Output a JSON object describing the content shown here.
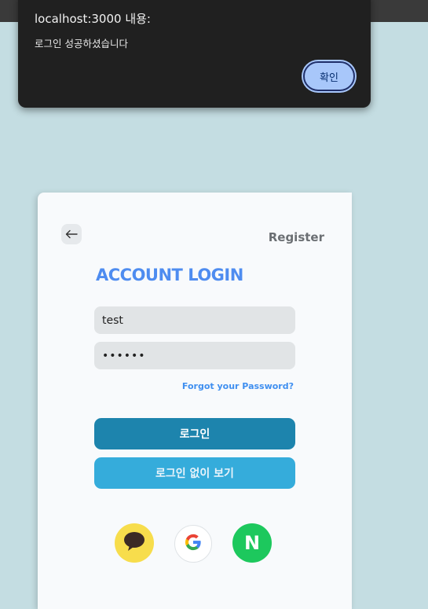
{
  "dialog": {
    "title": "localhost:3000 내용:",
    "message": "로그인 성공하셨습니다",
    "ok_label": "확인"
  },
  "card": {
    "back_icon": "arrow-left-icon",
    "register_label": "Register",
    "title": "ACCOUNT LOGIN",
    "username_value": "test",
    "password_value": "••••••",
    "forgot_label": "Forgot your Password?",
    "login_label": "로그인",
    "guest_label": "로그인 없이 보기",
    "social": {
      "kakao_icon": "kakao-talk-icon",
      "google_icon": "google-icon",
      "naver_icon": "naver-icon",
      "naver_letter": "N"
    }
  },
  "colors": {
    "background": "#c4dde2",
    "title": "#4e8cf0",
    "login_button": "#1d84ad",
    "guest_button": "#35acdb",
    "kakao": "#f7dd4c",
    "naver": "#1dc85d",
    "dialog_bg": "#202020",
    "dialog_button": "#a8c7fa"
  }
}
